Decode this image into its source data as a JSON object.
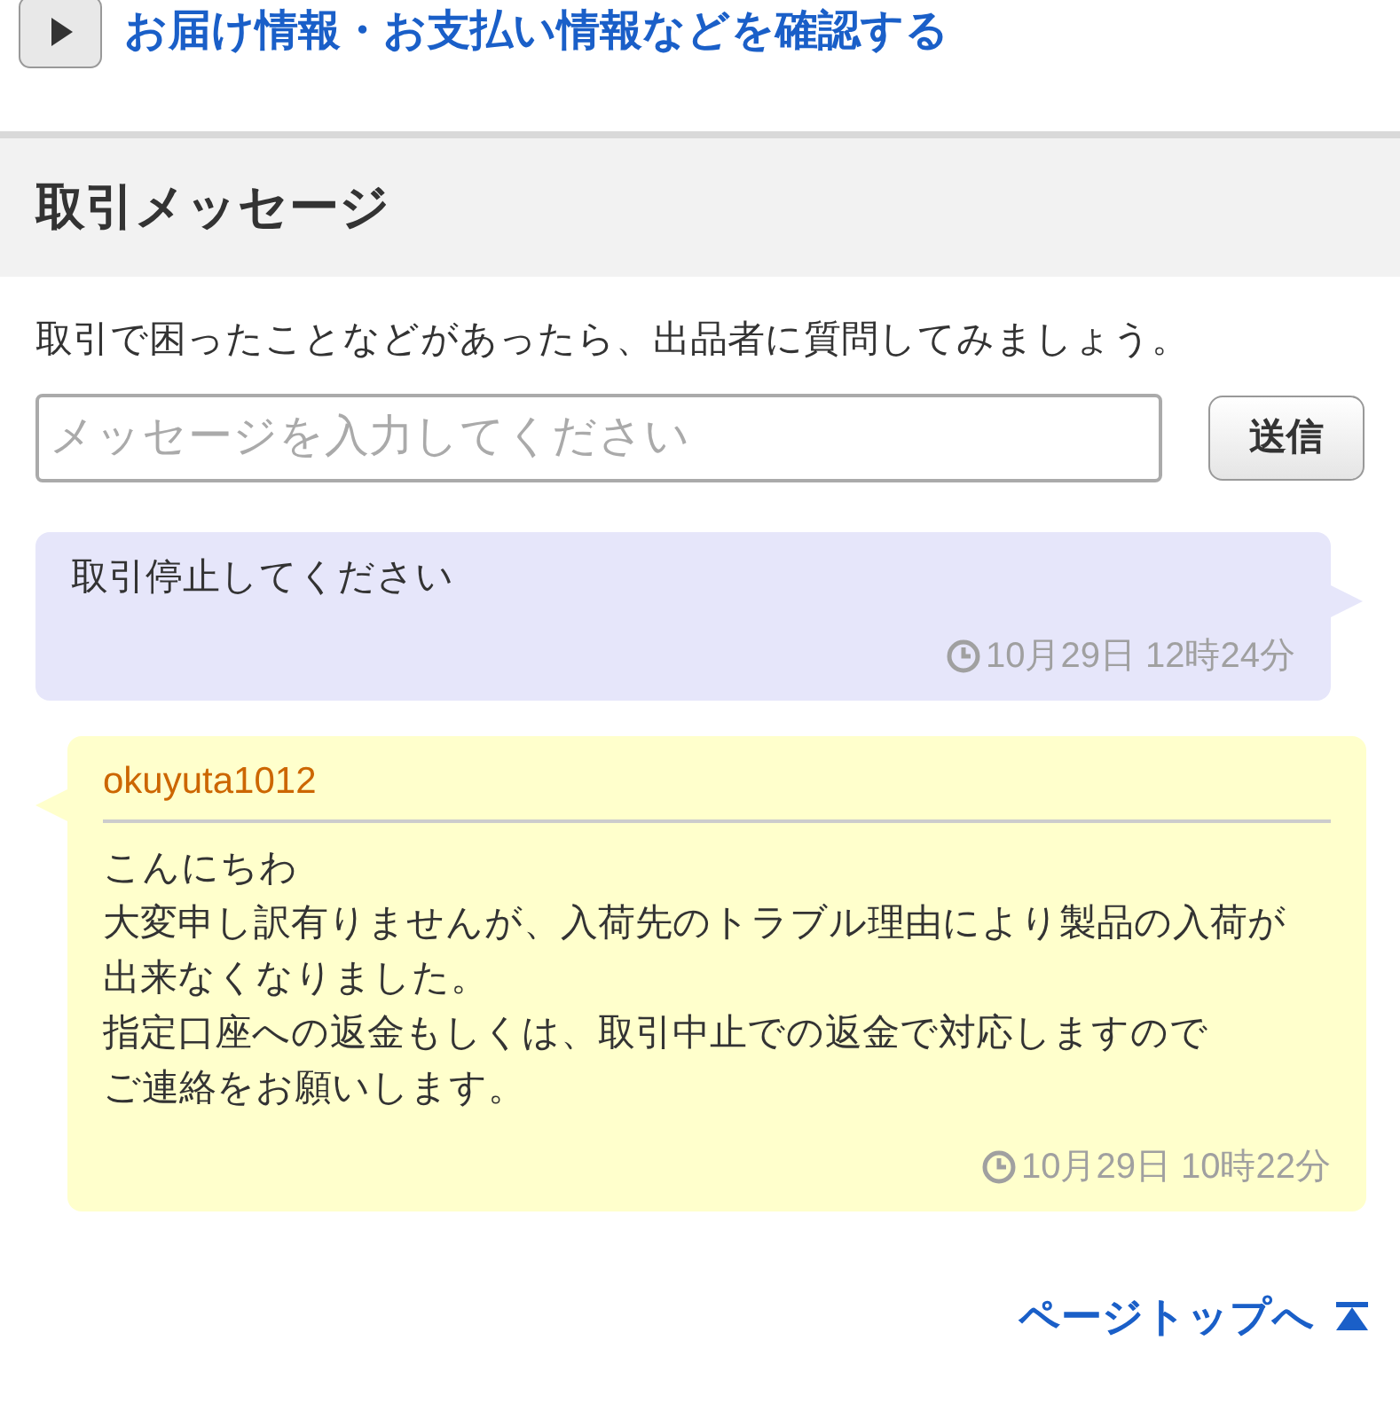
{
  "top_link": {
    "label": "お届け情報・お支払い情報などを確認する"
  },
  "section": {
    "title": "取引メッセージ"
  },
  "description": "取引で困ったことなどがあったら、出品者に質問してみましょう。",
  "message_input": {
    "placeholder": "メッセージを入力してください"
  },
  "send_button": "送信",
  "messages": [
    {
      "kind": "mine",
      "body": "取引停止してください",
      "time": "10月29日 12時24分"
    },
    {
      "kind": "other",
      "sender": "okuyuta1012",
      "body": [
        "こんにちわ",
        "大変申し訳有りませんが、入荷先のトラブル理由により製品の入荷が出来なくなりました。",
        "指定口座への返金もしくは、取引中止での返金で対応しますので",
        "ご連絡をお願いします。"
      ],
      "time": "10月29日 10時22分"
    }
  ],
  "page_top_link": "ページトップへ"
}
